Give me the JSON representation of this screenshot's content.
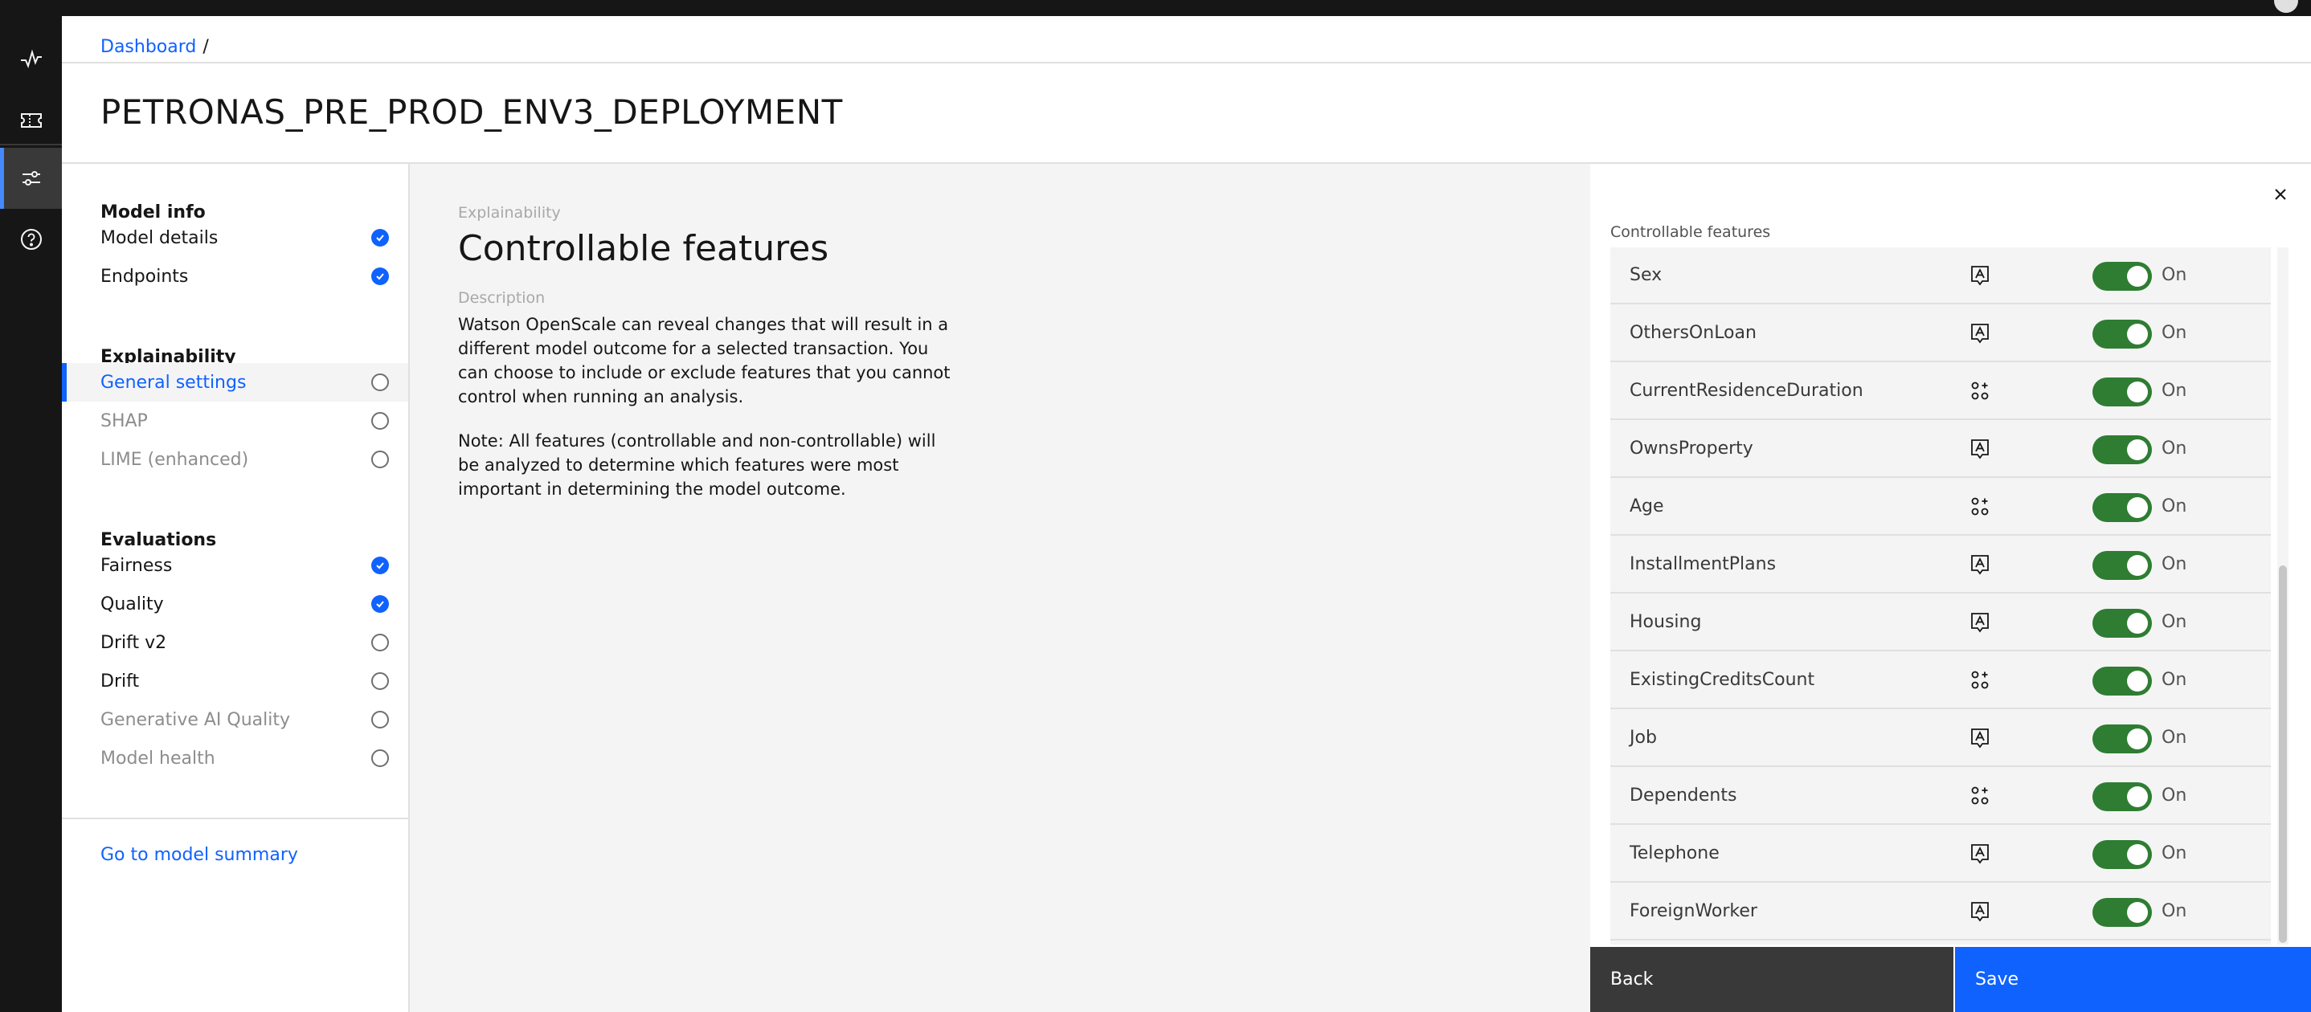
{
  "breadcrumb": {
    "root": "Dashboard",
    "separator": "/"
  },
  "page_title": "PETRONAS_PRE_PROD_ENV3_DEPLOYMENT",
  "rail": {
    "items": [
      {
        "icon": "activity-icon"
      },
      {
        "icon": "ticket-icon"
      },
      {
        "icon": "sliders-icon",
        "active": true
      },
      {
        "icon": "help-icon"
      }
    ]
  },
  "sidenav": {
    "model_info": {
      "heading": "Model info",
      "items": [
        {
          "label": "Model details",
          "status": "complete"
        },
        {
          "label": "Endpoints",
          "status": "complete"
        }
      ]
    },
    "explainability": {
      "heading": "Explainability",
      "items": [
        {
          "label": "General settings",
          "status": "incomplete",
          "selected": true
        },
        {
          "label": "SHAP",
          "status": "incomplete",
          "disabled": true
        },
        {
          "label": "LIME (enhanced)",
          "status": "incomplete",
          "disabled": true
        }
      ]
    },
    "evaluations": {
      "heading": "Evaluations",
      "items": [
        {
          "label": "Fairness",
          "status": "complete"
        },
        {
          "label": "Quality",
          "status": "complete"
        },
        {
          "label": "Drift v2",
          "status": "incomplete"
        },
        {
          "label": "Drift",
          "status": "incomplete"
        },
        {
          "label": "Generative AI Quality",
          "status": "incomplete",
          "disabled": true
        },
        {
          "label": "Model health",
          "status": "incomplete",
          "disabled": true
        }
      ]
    },
    "summary_link": "Go to model summary"
  },
  "main": {
    "eyebrow": "Explainability",
    "title": "Controllable features",
    "description_label": "Description",
    "description": "Watson OpenScale can reveal changes that will result in a different model outcome for a selected transaction. You can choose to include or exclude features that you cannot control when running an analysis.",
    "note": "Note: All features (controllable and non-controllable) will be analyzed to determine which features were most important in determining the model outcome."
  },
  "panel": {
    "label": "Controllable features",
    "features": [
      {
        "name": "Sex",
        "type_icon": "categorical-icon",
        "toggle": "On"
      },
      {
        "name": "OthersOnLoan",
        "type_icon": "categorical-icon",
        "toggle": "On"
      },
      {
        "name": "CurrentResidenceDuration",
        "type_icon": "numeric-icon",
        "toggle": "On"
      },
      {
        "name": "OwnsProperty",
        "type_icon": "categorical-icon",
        "toggle": "On"
      },
      {
        "name": "Age",
        "type_icon": "numeric-icon",
        "toggle": "On"
      },
      {
        "name": "InstallmentPlans",
        "type_icon": "categorical-icon",
        "toggle": "On"
      },
      {
        "name": "Housing",
        "type_icon": "categorical-icon",
        "toggle": "On"
      },
      {
        "name": "ExistingCreditsCount",
        "type_icon": "numeric-icon",
        "toggle": "On"
      },
      {
        "name": "Job",
        "type_icon": "categorical-icon",
        "toggle": "On"
      },
      {
        "name": "Dependents",
        "type_icon": "numeric-icon",
        "toggle": "On"
      },
      {
        "name": "Telephone",
        "type_icon": "categorical-icon",
        "toggle": "On"
      },
      {
        "name": "ForeignWorker",
        "type_icon": "categorical-icon",
        "toggle": "On"
      }
    ],
    "back_label": "Back",
    "save_label": "Save"
  },
  "colors": {
    "accent": "#0f62fe",
    "toggle_on": "#2e7d32",
    "rail_bg": "#161616"
  }
}
